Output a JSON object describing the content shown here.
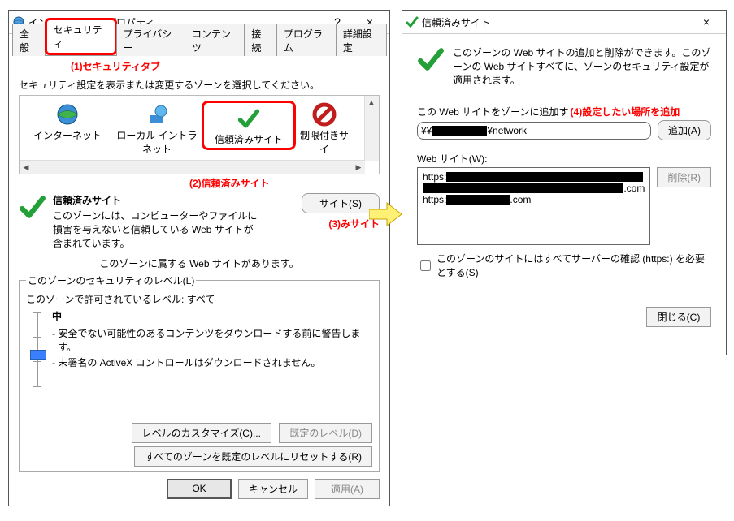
{
  "leftWindow": {
    "title": "インターネットのプロパティ",
    "help": "?",
    "close": "×",
    "tabs": [
      "全般",
      "セキュリティ",
      "プライバシー",
      "コンテンツ",
      "接続",
      "プログラム",
      "詳細設定"
    ],
    "activeTabIndex": 1,
    "anno1": "(1)セキュリティタブ",
    "zonePrompt": "セキュリティ設定を表示または変更するゾーンを選択してください。",
    "zones": [
      "インターネット",
      "ローカル イントラネット",
      "信頼済みサイト",
      "制限付きサイ"
    ],
    "anno2": "(2)信頼済みサイト",
    "zoneTitle": "信頼済みサイト",
    "zoneDesc": "このゾーンには、コンピューターやファイルに損害を与えないと信頼している Web サイトが含まれています。",
    "sitesBtn": "サイト(S)",
    "anno3": "(3)みサイト",
    "zoneHasSites": "このゾーンに属する Web サイトがあります。",
    "levelLegend": "このゾーンのセキュリティのレベル(L)",
    "allowedLevels": "このゾーンで許可されているレベル: すべて",
    "levelName": "中",
    "levelBullet1": "- 安全でない可能性のあるコンテンツをダウンロードする前に警告します。",
    "levelBullet2": "- 未署名の ActiveX コントロールはダウンロードされません。",
    "customBtn": "レベルのカスタマイズ(C)...",
    "defaultBtn": "既定のレベル(D)",
    "resetAllBtn": "すべてのゾーンを既定のレベルにリセットする(R)",
    "ok": "OK",
    "cancel": "キャンセル",
    "apply": "適用(A)"
  },
  "rightWindow": {
    "title": "信頼済みサイト",
    "close": "×",
    "desc": "このゾーンの Web サイトの追加と削除ができます。このゾーンの Web サイトすべてに、ゾーンのセキュリティ設定が適用されます。",
    "addPromptTrunc": "この Web サイトをゾーンに追加す",
    "anno4": "(4)設定したい場所を追加",
    "inputPrefix": "¥¥",
    "inputSuffix": "¥network",
    "addBtn": "追加(A)",
    "siteListLabel": "Web サイト(W):",
    "siteLine1_prefix": "https:",
    "siteLine2_suffix": ".com",
    "siteLine3_prefix": "https:",
    "siteLine3_suffix": ".com",
    "removeBtn": "削除(R)",
    "checkboxLabel": "このゾーンのサイトにはすべてサーバーの確認 (https:) を必要とする(S)",
    "closeBtn": "閉じる(C)"
  }
}
